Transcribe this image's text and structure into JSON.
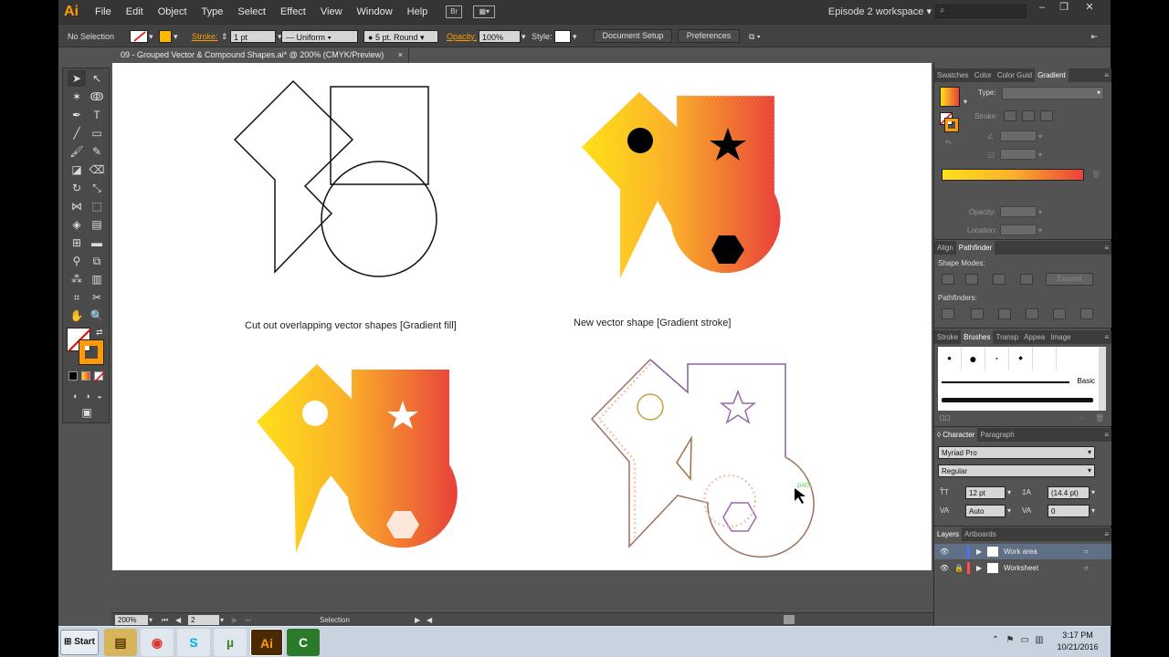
{
  "app": {
    "logo": "Ai"
  },
  "menubar": {
    "items": [
      "File",
      "Edit",
      "Object",
      "Type",
      "Select",
      "Effect",
      "View",
      "Window",
      "Help"
    ],
    "bridge_label": "Br",
    "workspace": "Episode 2 workspace",
    "search_placeholder": ""
  },
  "controlbar": {
    "selection": "No Selection",
    "stroke_label": "Stroke:",
    "stroke_weight": "1 pt",
    "profile": "Uniform",
    "brush": "5 pt. Round",
    "opacity_label": "Opacity:",
    "opacity": "100%",
    "style_label": "Style:",
    "document_setup": "Document Setup",
    "preferences": "Preferences"
  },
  "document": {
    "tab_title": "09 - Grouped Vector & Compound Shapes.ai* @ 200% (CMYK/Preview)",
    "close": "×"
  },
  "artboard": {
    "caption_left": "Cut out overlapping vector shapes [Gradient fill]",
    "caption_right": "New vector shape [Gradient stroke]",
    "hover_label": "path"
  },
  "statusbar": {
    "zoom": "200%",
    "artboard": "2",
    "tool": "Selection"
  },
  "panels": {
    "gradient": {
      "tabs": [
        "Swatches",
        "Color",
        "Color Guid",
        "Gradient"
      ],
      "active_tab": 3,
      "type_label": "Type:",
      "stroke_label": "Stroke:",
      "opacity_label": "Opacity:",
      "location_label": "Location:",
      "gradient_start": "#ffe01a",
      "gradient_end": "#e8413a"
    },
    "pathfinder": {
      "tabs": [
        "Align",
        "Pathfinder"
      ],
      "active_tab": 1,
      "shape_modes": "Shape Modes:",
      "expand": "Expand",
      "pathfinders": "Pathfinders:"
    },
    "brushes": {
      "tabs": [
        "Stroke",
        "Brushes",
        "Transp",
        "Appea",
        "Image"
      ],
      "active_tab": 1,
      "basic": "Basic"
    },
    "character": {
      "tabs": [
        "Character",
        "Paragraph"
      ],
      "active_tab": 0,
      "font": "Myriad Pro",
      "style": "Regular",
      "size": "12 pt",
      "leading": "(14.4 pt)",
      "kerning": "Auto",
      "tracking": "0"
    },
    "layers": {
      "tabs": [
        "Layers",
        "Artboards"
      ],
      "active_tab": 0,
      "rows": [
        {
          "name": "Work area",
          "color": "#4f6fff"
        },
        {
          "name": "Worksheet",
          "color": "#ff4f4f"
        }
      ]
    }
  },
  "taskbar": {
    "start": "Start",
    "time": "3:17 PM",
    "date": "10/21/2016"
  }
}
